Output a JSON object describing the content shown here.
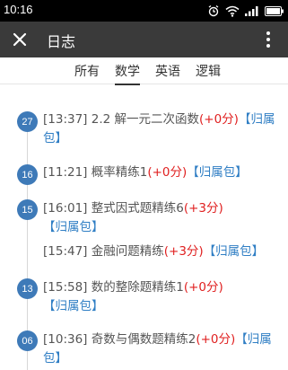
{
  "status_bar": {
    "time": "10:16",
    "icons": [
      "alarm-icon",
      "wifi-icon",
      "signal-icon",
      "battery-icon"
    ]
  },
  "app_bar": {
    "title": "日志",
    "left_icon": "close-icon",
    "right_icon": "more-vert-icon"
  },
  "tabs": [
    {
      "label": "所有",
      "active": false
    },
    {
      "label": "数学",
      "active": true
    },
    {
      "label": "英语",
      "active": false
    },
    {
      "label": "逻辑",
      "active": false
    }
  ],
  "entries": [
    {
      "day": "27",
      "time": "[13:37]",
      "title": "2.2 解一元二次函数",
      "score": "(+0分)",
      "pkg": "【归属包】"
    },
    {
      "day": "16",
      "time": "[11:21]",
      "title": "概率精练1",
      "score": "(+0分)",
      "pkg": "【归属包】"
    },
    {
      "day": "15",
      "time": "[16:01]",
      "title": "整式因式题精练6",
      "score": "(+3分)",
      "pkg": "【归属包】"
    },
    {
      "day": "",
      "time": "[15:47]",
      "title": "金融问题精练",
      "score": "(+3分)",
      "pkg": "【归属包】"
    },
    {
      "day": "13",
      "time": "[15:58]",
      "title": "数的整除题精练1",
      "score": "(+0分)",
      "pkg": "【归属包】"
    },
    {
      "day": "06",
      "time": "[10:36]",
      "title": "奇数与偶数题精练2",
      "score": "(+0分)",
      "pkg": "【归属包】"
    }
  ],
  "colors": {
    "app_bar": "#3a3a3a",
    "badge": "#3e7ab8",
    "score": "#e02020",
    "package_link": "#2f7ec4"
  }
}
